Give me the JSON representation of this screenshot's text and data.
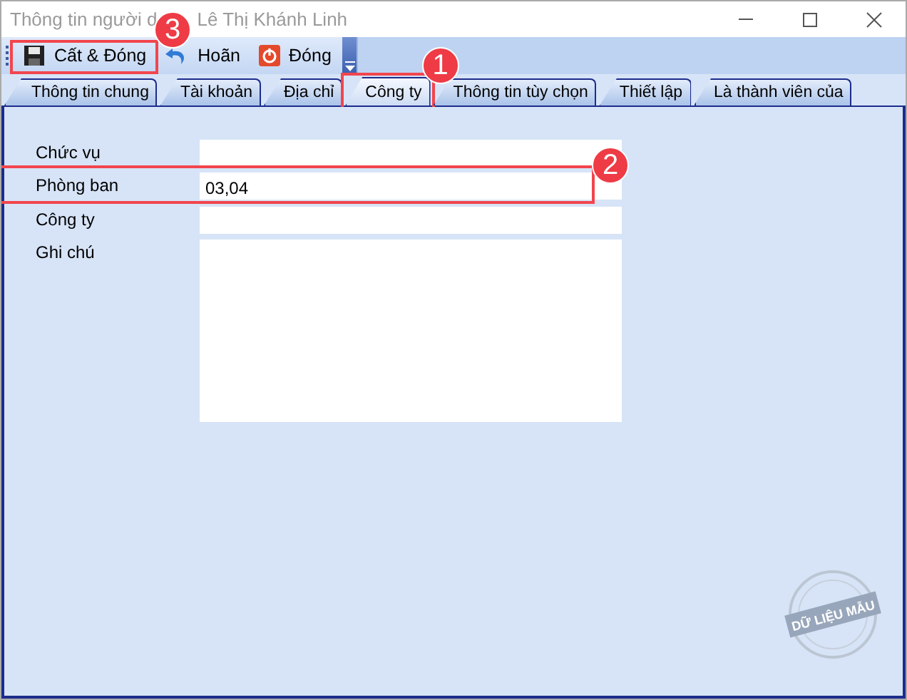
{
  "window": {
    "title_parts": [
      "Thông tin người d",
      "Lê Thị Khánh Linh"
    ]
  },
  "toolbar": [
    {
      "kind": "save",
      "label": "Cất & Đóng",
      "marker": "3"
    },
    {
      "kind": "undo",
      "label": "Hoãn"
    },
    {
      "kind": "close",
      "label": "Đóng"
    }
  ],
  "tabs": [
    {
      "label": "Thông tin chung",
      "selected": false
    },
    {
      "label": "Tài khoản",
      "selected": false
    },
    {
      "label": "Địa chỉ",
      "selected": false
    },
    {
      "label": "Công ty",
      "selected": true,
      "marker": "1"
    },
    {
      "label": "Thông tin tùy chọn",
      "selected": false
    },
    {
      "label": "Thiết lập",
      "selected": false
    },
    {
      "label": "Là thành viên của",
      "selected": false
    }
  ],
  "fields": [
    {
      "kind": "line",
      "label": "Chức vụ"
    },
    {
      "kind": "line",
      "label": "Phòng ban",
      "value": "03,04",
      "marker": "2"
    },
    {
      "kind": "line",
      "label": "Công ty"
    },
    {
      "kind": "area",
      "label": "Ghi chú"
    }
  ],
  "stamp": "DỮ LIỆU MẪU"
}
